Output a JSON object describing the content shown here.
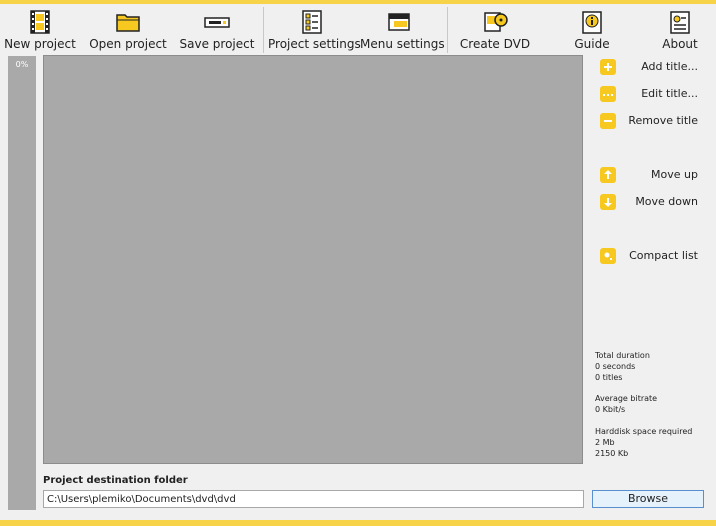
{
  "toolbar": {
    "new_project": "New project",
    "open_project": "Open project",
    "save_project": "Save project",
    "project_settings": "Project settings",
    "menu_settings": "Menu settings",
    "create_dvd": "Create DVD",
    "guide": "Guide",
    "about": "About"
  },
  "progress": {
    "label": "0%",
    "value": 0
  },
  "sidebar": {
    "add_title": "Add title...",
    "edit_title": "Edit title...",
    "remove_title": "Remove title",
    "move_up": "Move up",
    "move_down": "Move down",
    "compact_list": "Compact list"
  },
  "stats": {
    "total_duration_label": "Total duration",
    "total_duration_value": "0 seconds",
    "titles_value": "0 titles",
    "average_bitrate_label": "Average bitrate",
    "average_bitrate_value": "0 Kbit/s",
    "harddisk_label": "Harddisk space required",
    "harddisk_mb": "2 Mb",
    "harddisk_kb": "2150 Kb"
  },
  "destination": {
    "label": "Project destination folder",
    "value": "C:\\Users\\plemiko\\Documents\\dvd\\dvd"
  },
  "browse_label": "Browse",
  "colors": {
    "accent": "#f7c81f",
    "panel_gray": "#a9a9a9"
  }
}
